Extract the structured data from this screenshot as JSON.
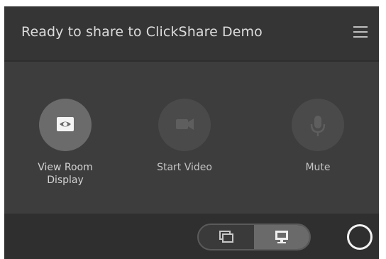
{
  "header": {
    "title": "Ready to share to ClickShare Demo",
    "menu_icon": "hamburger-menu-icon"
  },
  "controls": [
    {
      "label": "View Room Display",
      "icon": "eye-screen-icon",
      "state": "active"
    },
    {
      "label": "Start Video",
      "icon": "video-camera-icon",
      "state": "disabled"
    },
    {
      "label": "Mute",
      "icon": "microphone-icon",
      "state": "disabled"
    }
  ],
  "bottom_bar": {
    "toggle": {
      "left_icon": "window-share-icon",
      "right_icon": "monitor-share-icon",
      "selected": "right"
    },
    "share_button_icon": "ring-icon"
  },
  "colors": {
    "background": "#3b3b3b",
    "header": "#353535",
    "active_circle": "#6b6b6b",
    "inactive_circle": "#4a4a4a",
    "text": "#dcdcdc"
  }
}
